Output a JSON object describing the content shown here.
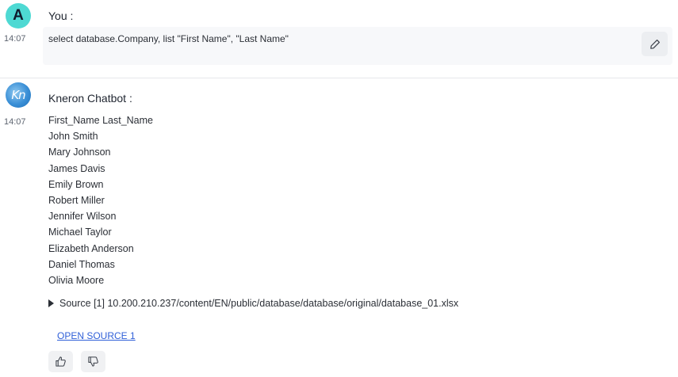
{
  "user_message": {
    "avatar_letter": "A",
    "sender": "You :",
    "time": "14:07",
    "text": "select database.Company, list \"First Name\", \"Last Name\"",
    "edit_icon": "pencil-icon"
  },
  "bot_message": {
    "avatar_text": "Kn",
    "sender": "Kneron Chatbot :",
    "time": "14:07",
    "lines": [
      "First_Name Last_Name",
      "John Smith",
      "Mary Johnson",
      "James Davis",
      "Emily Brown",
      "Robert Miller",
      "Jennifer Wilson",
      "Michael Taylor",
      "Elizabeth Anderson",
      "Daniel Thomas",
      "Olivia Moore"
    ],
    "source": "Source [1] 10.200.210.237/content/EN/public/database/database/original/database_01.xlsx",
    "open_source_label": "OPEN SOURCE 1",
    "thumbs_up_icon": "thumbs-up-icon",
    "thumbs_down_icon": "thumbs-down-icon"
  },
  "colors": {
    "user_avatar": "#4ed9d3",
    "link": "#2f5fd8",
    "bubble": "#f7f8fa"
  }
}
